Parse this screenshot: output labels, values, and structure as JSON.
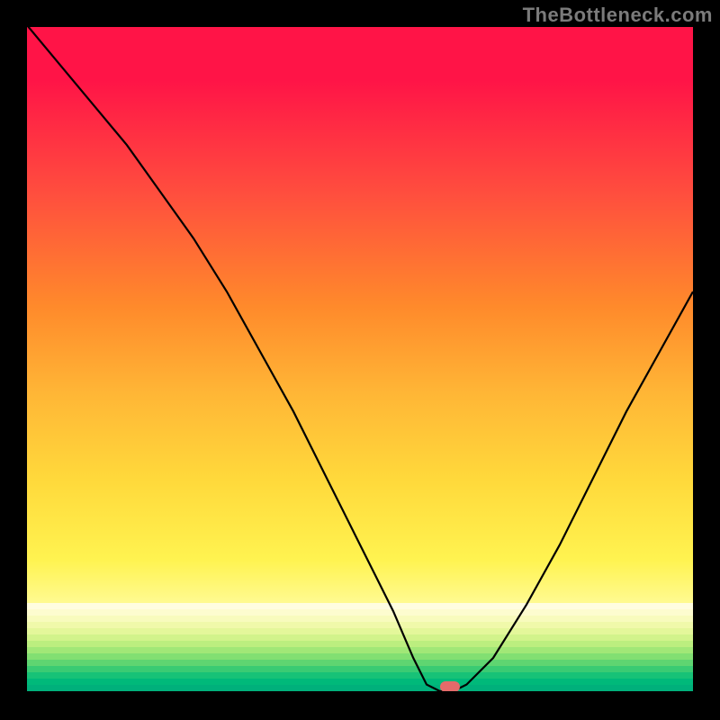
{
  "watermark": "TheBottleneck.com",
  "chart_data": {
    "type": "line",
    "title": "",
    "xlabel": "",
    "ylabel": "",
    "xlim": [
      0,
      100
    ],
    "ylim": [
      0,
      100
    ],
    "x": [
      0,
      5,
      10,
      15,
      20,
      25,
      30,
      35,
      40,
      45,
      50,
      55,
      58,
      60,
      62,
      64,
      66,
      70,
      75,
      80,
      85,
      90,
      95,
      100
    ],
    "values": [
      100,
      94,
      88,
      82,
      75,
      68,
      60,
      51,
      42,
      32,
      22,
      12,
      5,
      1,
      0,
      0,
      1,
      5,
      13,
      22,
      32,
      42,
      51,
      60
    ],
    "minimum_x": 63,
    "gradient_stops": [
      {
        "pct": 0,
        "color": "#ff1447"
      },
      {
        "pct": 25,
        "color": "#ff8a2b"
      },
      {
        "pct": 55,
        "color": "#ffd93b"
      },
      {
        "pct": 85,
        "color": "#fffca0"
      },
      {
        "pct": 95,
        "color": "#d6ffb0"
      },
      {
        "pct": 100,
        "color": "#00e37a"
      }
    ],
    "bottom_strips": [
      "#fffde0",
      "#fdfccf",
      "#f8fbbd",
      "#f0f9aa",
      "#e4f79a",
      "#d2f38b",
      "#bcee7f",
      "#a1e777",
      "#82df72",
      "#5fd571",
      "#3acb73",
      "#17c277",
      "#00b97a",
      "#00b07b"
    ],
    "marker": {
      "x_pct": 63.5,
      "y_pct": 99.1,
      "color": "#e46a6a"
    }
  }
}
